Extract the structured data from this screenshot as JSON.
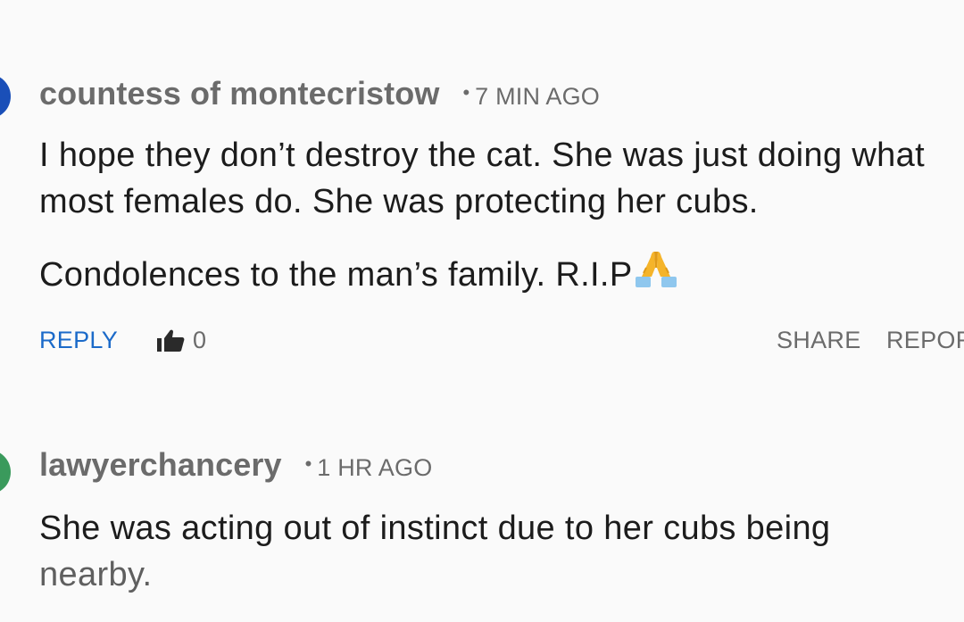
{
  "comments": [
    {
      "avatar_color": "#1a4fb8",
      "username": "countess of montecristow",
      "separator": "•",
      "time": "7 MIN AGO",
      "paragraph1": "I hope they don’t destroy the cat. She was just doing what most females do. She was protecting her cubs.",
      "paragraph2": "Condolences to the man’s family. R.I.P",
      "emoji_icon": "folded-hands-icon",
      "actions": {
        "reply": "REPLY",
        "like_icon": "thumbs-up-icon",
        "like_count": "0",
        "share": "SHARE",
        "report": "REPOR"
      }
    },
    {
      "avatar_color": "#3a9a5c",
      "username": "lawyerchancery",
      "separator": "•",
      "time": "1 HR AGO",
      "line1": "She was acting out of instinct due to her cubs being",
      "line2": "nearby."
    }
  ],
  "colors": {
    "link_blue": "#1b6ac9",
    "meta_gray": "#6b6b6b",
    "text": "#1c1c1c",
    "background": "#fafafa"
  }
}
